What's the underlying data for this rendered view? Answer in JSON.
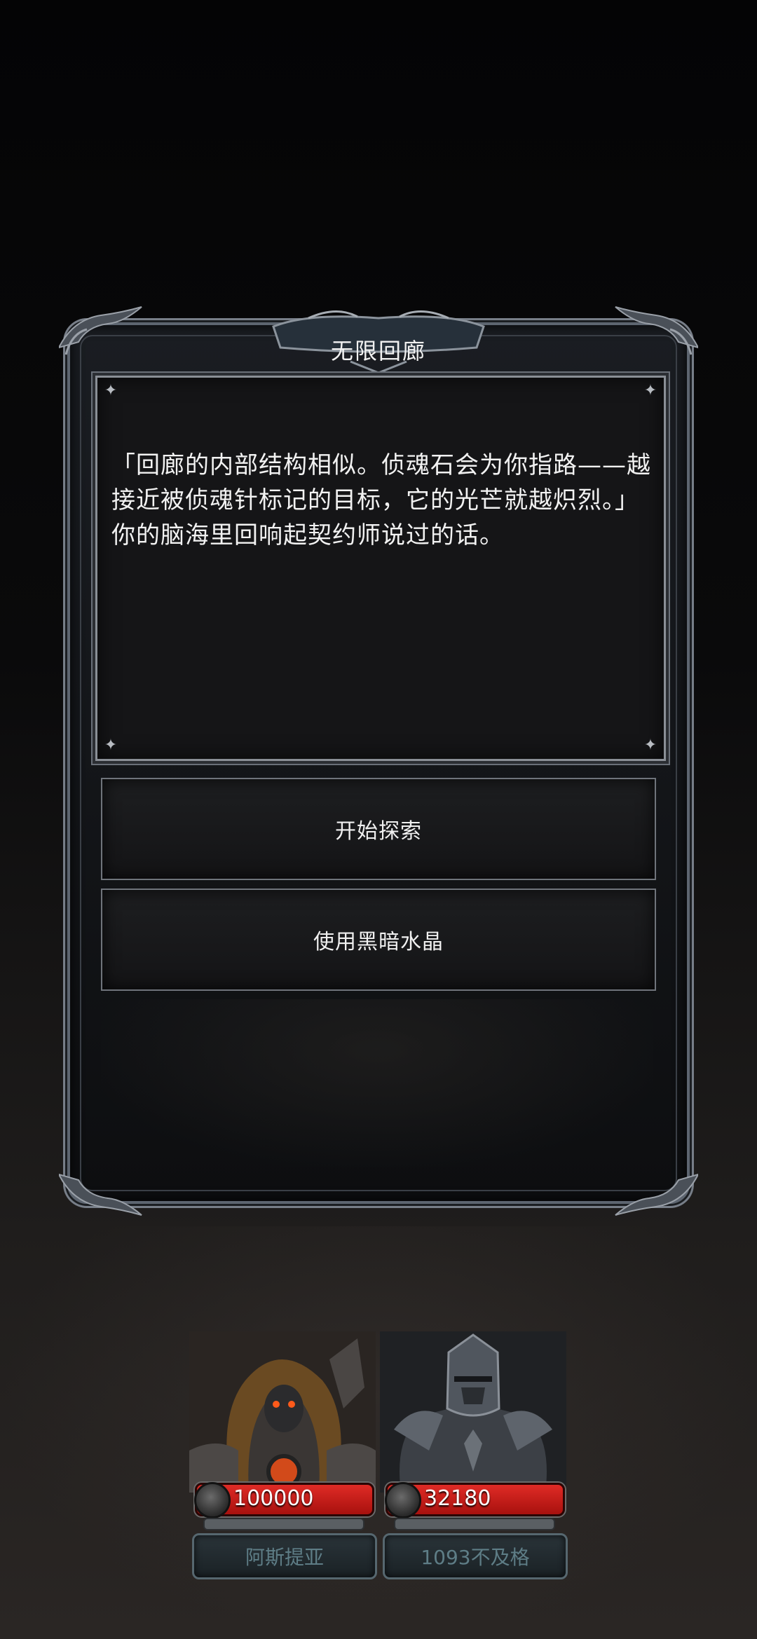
{
  "dialog": {
    "title": "无限回廊",
    "story_text": "「回廊的内部结构相似。侦魂石会为你指路——越接近被侦魂针标记的目标，它的光芒就越炽烈。」你的脑海里回响起契约师说过的话。",
    "choices": [
      {
        "label": "开始探索"
      },
      {
        "label": "使用黑暗水晶"
      }
    ]
  },
  "party": [
    {
      "name": "阿斯提亚",
      "hp": "100000"
    },
    {
      "name": "1093不及格",
      "hp": "32180"
    }
  ],
  "colors": {
    "hp_bar": "#c81c18",
    "name_text": "#5e7d86",
    "frame_metal": "#6a7079"
  }
}
